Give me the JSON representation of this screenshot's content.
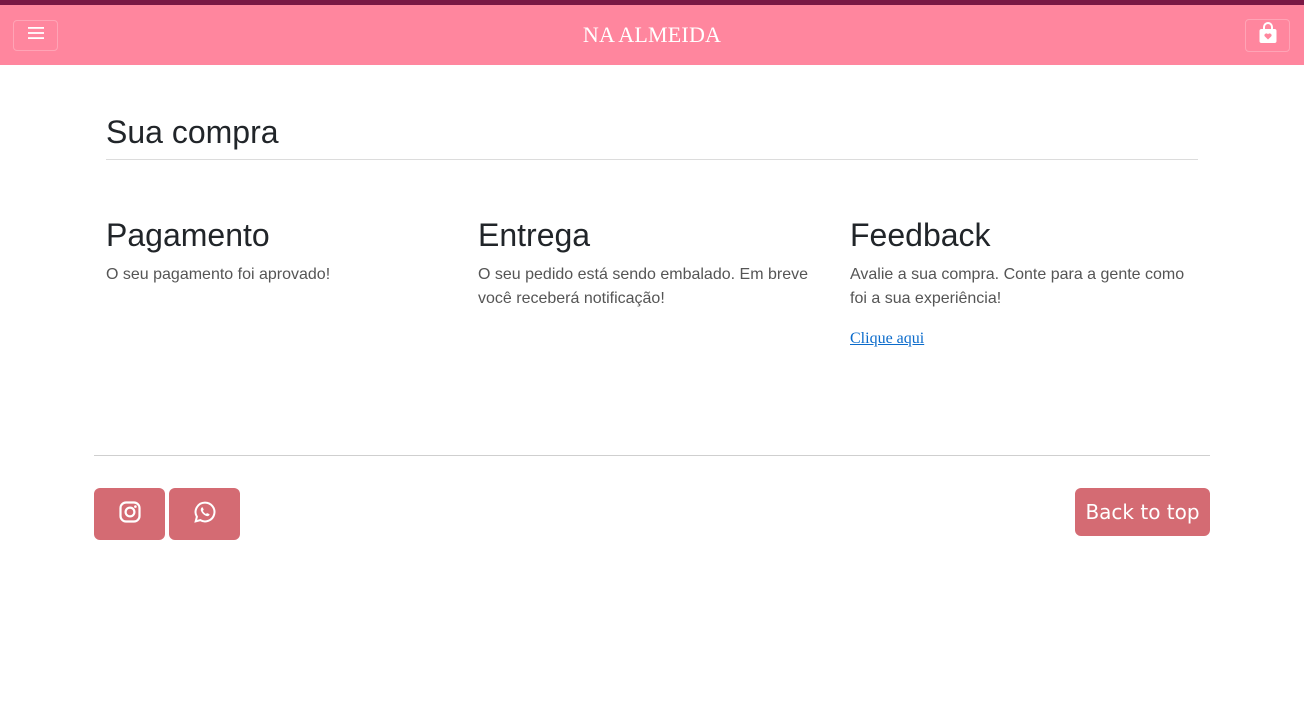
{
  "header": {
    "brand": "NA ALMEIDA",
    "menu_icon": "hamburger-icon",
    "cart_icon": "shopping-bag-icon",
    "colors": {
      "topline": "#7a1744",
      "navbar": "#ff869e"
    }
  },
  "main": {
    "title": "Sua compra",
    "columns": [
      {
        "heading": "Pagamento",
        "text": "O seu pagamento foi aprovado!"
      },
      {
        "heading": "Entrega",
        "text": "O seu pedido está sendo embalado. Em breve você receberá notificação!"
      },
      {
        "heading": "Feedback",
        "text": "Avalie a sua compra. Conte para a gente como foi a sua experiência!",
        "link": "Clique aqui"
      }
    ]
  },
  "footer": {
    "social": [
      {
        "icon": "instagram-icon"
      },
      {
        "icon": "whatsapp-icon"
      }
    ],
    "back_to_top": "Back to top",
    "button_color": "#d46b73"
  }
}
